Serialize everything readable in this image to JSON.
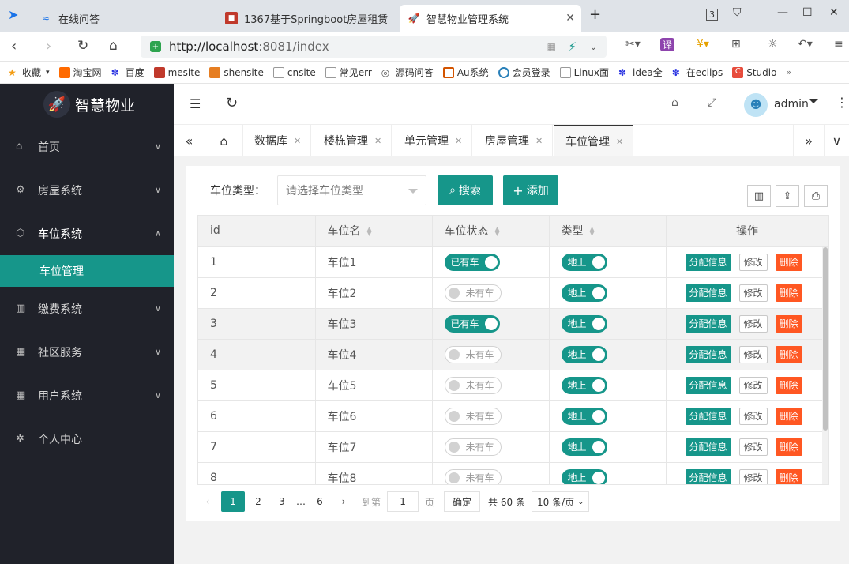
{
  "browser": {
    "tabs": [
      {
        "label": "在线问答"
      },
      {
        "label": "1367基于Springboot房屋租赁"
      },
      {
        "label": "智慧物业管理系统"
      }
    ],
    "url_host": "http://localhost",
    "url_rest": ":8081/index",
    "bookmarks": [
      "收藏",
      "淘宝网",
      "百度",
      "mesite",
      "shensite",
      "cnsite",
      "常见err",
      "源码问答",
      "Au系统",
      "会员登录",
      "Linux面",
      "idea全",
      "在eclips",
      "Studio"
    ],
    "tab_count": "3"
  },
  "app": {
    "logo_text": "智慧物业",
    "user": "admin"
  },
  "sidebar": {
    "items": [
      {
        "label": "首页"
      },
      {
        "label": "房屋系统"
      },
      {
        "label": "车位系统"
      },
      {
        "label": "缴费系统"
      },
      {
        "label": "社区服务"
      },
      {
        "label": "用户系统"
      },
      {
        "label": "个人中心"
      }
    ],
    "sub_item": "车位管理"
  },
  "page_tabs": [
    "数据库",
    "楼栋管理",
    "单元管理",
    "房屋管理",
    "车位管理"
  ],
  "search": {
    "label": "车位类型：",
    "placeholder": "请选择车位类型",
    "search_btn": "搜索",
    "add_btn": "添加"
  },
  "table": {
    "headers": [
      "id",
      "车位名",
      "车位状态",
      "类型",
      "操作"
    ],
    "rows": [
      {
        "id": "1",
        "name": "车位1",
        "status": "已有车",
        "status_on": true,
        "type": "地上"
      },
      {
        "id": "2",
        "name": "车位2",
        "status": "未有车",
        "status_on": false,
        "type": "地上"
      },
      {
        "id": "3",
        "name": "车位3",
        "status": "已有车",
        "status_on": true,
        "type": "地上"
      },
      {
        "id": "4",
        "name": "车位4",
        "status": "未有车",
        "status_on": false,
        "type": "地上"
      },
      {
        "id": "5",
        "name": "车位5",
        "status": "未有车",
        "status_on": false,
        "type": "地上"
      },
      {
        "id": "6",
        "name": "车位6",
        "status": "未有车",
        "status_on": false,
        "type": "地上"
      },
      {
        "id": "7",
        "name": "车位7",
        "status": "未有车",
        "status_on": false,
        "type": "地上"
      },
      {
        "id": "8",
        "name": "车位8",
        "status": "未有车",
        "status_on": false,
        "type": "地上"
      }
    ],
    "actions": {
      "assign": "分配信息",
      "edit": "修改",
      "delete": "删除"
    }
  },
  "pager": {
    "pages": [
      "1",
      "2",
      "3",
      "…",
      "6"
    ],
    "goto_label": "到第",
    "goto_value": "1",
    "page_unit": "页",
    "confirm": "确定",
    "total": "共 60 条",
    "per_page": "10 条/页"
  },
  "colors": {
    "accent": "#16968a",
    "danger": "#ff5722",
    "sidebar_bg": "#20222a"
  }
}
